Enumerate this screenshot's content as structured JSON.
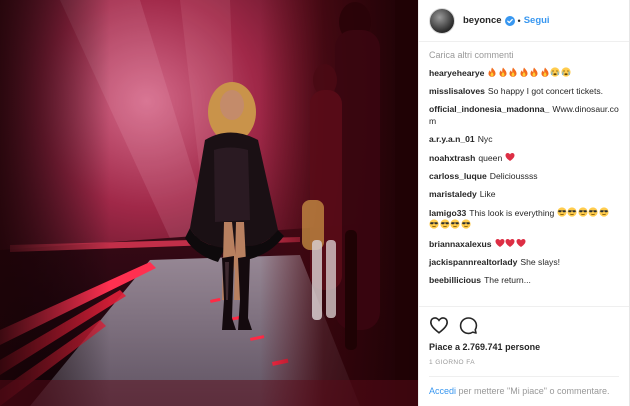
{
  "post": {
    "username": "beyonce",
    "follow_label": "Segui",
    "load_more": "Carica altri commenti",
    "comments": [
      {
        "user": "hearyehearye",
        "text": "",
        "emoji": [
          "fire",
          "fire",
          "fire",
          "fire",
          "fire",
          "fire",
          "crying",
          "crying"
        ]
      },
      {
        "user": "misslisaloves",
        "text": "So happy I got concert tickets.",
        "emoji": []
      },
      {
        "user": "official_indonesia_madonna_",
        "text": "Www.dinosaur.com",
        "emoji": []
      },
      {
        "user": "a.r.y.a.n_01",
        "text": "Nyc",
        "emoji": []
      },
      {
        "user": "noahxtrash",
        "text": "queen",
        "emoji": [
          "heart"
        ]
      },
      {
        "user": "carloss_luque",
        "text": "Delicioussss",
        "emoji": []
      },
      {
        "user": "maristaledy",
        "text": "Like",
        "emoji": []
      },
      {
        "user": "lamigo33",
        "text": "This look is everything",
        "emoji": [
          "sunglasses",
          "sunglasses",
          "sunglasses",
          "sunglasses",
          "sunglasses",
          "sunglasses",
          "sunglasses",
          "sunglasses",
          "sunglasses"
        ]
      },
      {
        "user": "briannaxalexus",
        "text": "",
        "emoji": [
          "heart",
          "heart",
          "heart"
        ]
      },
      {
        "user": "jackispannrealtorlady",
        "text": "She slays!",
        "emoji": []
      },
      {
        "user": "beebillicious",
        "text": "The return...",
        "emoji": []
      }
    ],
    "likes_text": "Piace a 2.769.741 persone",
    "time_text": "1 GIORNO FA",
    "login_link": "Accedi",
    "login_text": "per mettere \"Mi piace\" o commentare."
  },
  "colors": {
    "link_blue": "#3897f0",
    "verified_blue": "#3897f0",
    "muted_gray": "#999999",
    "stage_red": "#e0203a"
  },
  "icons": {
    "like": "heart-outline-icon",
    "comment": "speech-bubble-icon",
    "verified": "verified-badge-icon"
  }
}
